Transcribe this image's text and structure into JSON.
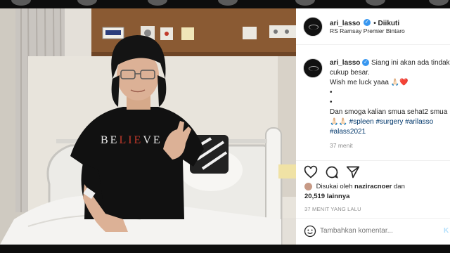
{
  "post": {
    "username": "ari_lasso",
    "follow_label": "• Diikuti",
    "location": "RS Ramsay Premier Bintaro",
    "caption_lines": [
      "Siang ini akan ada tindakan",
      "cukup besar.",
      "Wish me luck yaaa 🙏🏻❤️",
      "•",
      "•",
      "Dan smoga kalian smua sehat2 smua"
    ],
    "hashtags": "🙏🏻🙏🏻 #spleen #surgery #arilasso",
    "hashtags2": "#alass2021",
    "caption_time": "37 menit",
    "liked_by_prefix": "Disukai oleh",
    "liked_by_user": "naziracnoer",
    "liked_by_and": "dan",
    "likes_count": "20,519 lainnya",
    "timestamp": "37 MENIT YANG LALU",
    "comment_placeholder": "Tambahkan komentar...",
    "post_button": "K"
  },
  "photo": {
    "shirt_text_parts": [
      "BE",
      "LIE",
      "VE"
    ]
  },
  "icons": {
    "verified": "verified-badge-icon",
    "like": "heart-icon",
    "comment": "comment-icon",
    "share": "share-icon",
    "emoji": "emoji-icon"
  },
  "colors": {
    "verified": "#3897f0",
    "hashtag": "#00376b",
    "muted": "#8e8e8e",
    "shirt": "#111111",
    "shirt_accent": "#c0392b"
  }
}
